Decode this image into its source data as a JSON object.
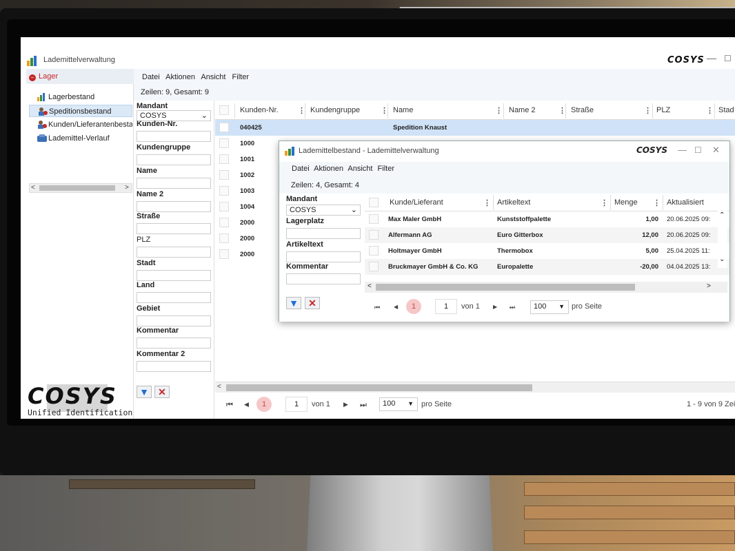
{
  "main": {
    "window_title": "Lademittelverwaltung",
    "logo_small": "COSYS",
    "win_minimize": "—",
    "win_maximize": "☐",
    "sidebar": {
      "header": "Lager",
      "items": [
        {
          "label": "Lagerbestand"
        },
        {
          "label": "Speditionsbestand"
        },
        {
          "label": "Kunden/Lieferantenbestand"
        },
        {
          "label": "Lademittel-Verlauf"
        }
      ],
      "logo_text": "COSYS",
      "logo_subtitle": "Unified Identification"
    },
    "menu": [
      "Datei",
      "Aktionen",
      "Ansicht",
      "Filter"
    ],
    "rows_info": "Zeilen: 9, Gesamt: 9",
    "filter": {
      "mandant_label": "Mandant",
      "mandant_value": "COSYS",
      "fields": [
        "Kunden-Nr.",
        "Kundengruppe",
        "Name",
        "Name 2",
        "Straße",
        "PLZ",
        "Stadt",
        "Land",
        "Gebiet",
        "Kommentar",
        "Kommentar 2"
      ]
    },
    "columns": [
      "Kunden-Nr.",
      "Kundengruppe",
      "Name",
      "Name 2",
      "Straße",
      "PLZ",
      "Stad"
    ],
    "rows": [
      {
        "kunden_nr": "040425",
        "name": "Spedition Knaust"
      },
      {
        "kunden_nr": "1000",
        "name": ""
      },
      {
        "kunden_nr": "1001",
        "name": ""
      },
      {
        "kunden_nr": "1002",
        "name": ""
      },
      {
        "kunden_nr": "1003",
        "name": ""
      },
      {
        "kunden_nr": "1004",
        "name": ""
      },
      {
        "kunden_nr": "2000",
        "name": ""
      },
      {
        "kunden_nr": "2000",
        "name": ""
      },
      {
        "kunden_nr": "2000",
        "name": ""
      }
    ],
    "pager": {
      "current": "1",
      "page_input": "1",
      "of_label": "von 1",
      "per_page": "100",
      "per_page_label": "pro Seite",
      "summary": "1 - 9 von 9 Zei"
    }
  },
  "dialog": {
    "title": "Lademittelbestand - Lademittelverwaltung",
    "logo_small": "COSYS",
    "menu": [
      "Datei",
      "Aktionen",
      "Ansicht",
      "Filter"
    ],
    "rows_info": "Zeilen: 4, Gesamt: 4",
    "filter": {
      "mandant_label": "Mandant",
      "mandant_value": "COSYS",
      "fields": [
        "Lagerplatz",
        "Artikeltext",
        "Kommentar"
      ]
    },
    "columns": [
      "Kunde/Lieferant",
      "Artikeltext",
      "Menge",
      "Aktualisiert"
    ],
    "rows": [
      {
        "kunde": "Max Maler GmbH",
        "artikel": "Kunststoffpalette",
        "menge": "1,00",
        "datum": "20.06.2025 09:"
      },
      {
        "kunde": "Alfermann AG",
        "artikel": "Euro Gitterbox",
        "menge": "12,00",
        "datum": "20.06.2025 09:"
      },
      {
        "kunde": "Holtmayer GmbH",
        "artikel": "Thermobox",
        "menge": "5,00",
        "datum": "25.04.2025 11:"
      },
      {
        "kunde": "Bruckmayer GmbH & Co. KG",
        "artikel": "Europalette",
        "menge": "-20,00",
        "datum": "04.04.2025 13:"
      }
    ],
    "pager": {
      "current": "1",
      "page_input": "1",
      "of_label": "von 1",
      "per_page": "100",
      "per_page_label": "pro Seite"
    }
  },
  "colors": {
    "accent_red": "#c62828",
    "selection_blue": "#cfe2f7",
    "filter_blue": "#1e6fd1"
  }
}
